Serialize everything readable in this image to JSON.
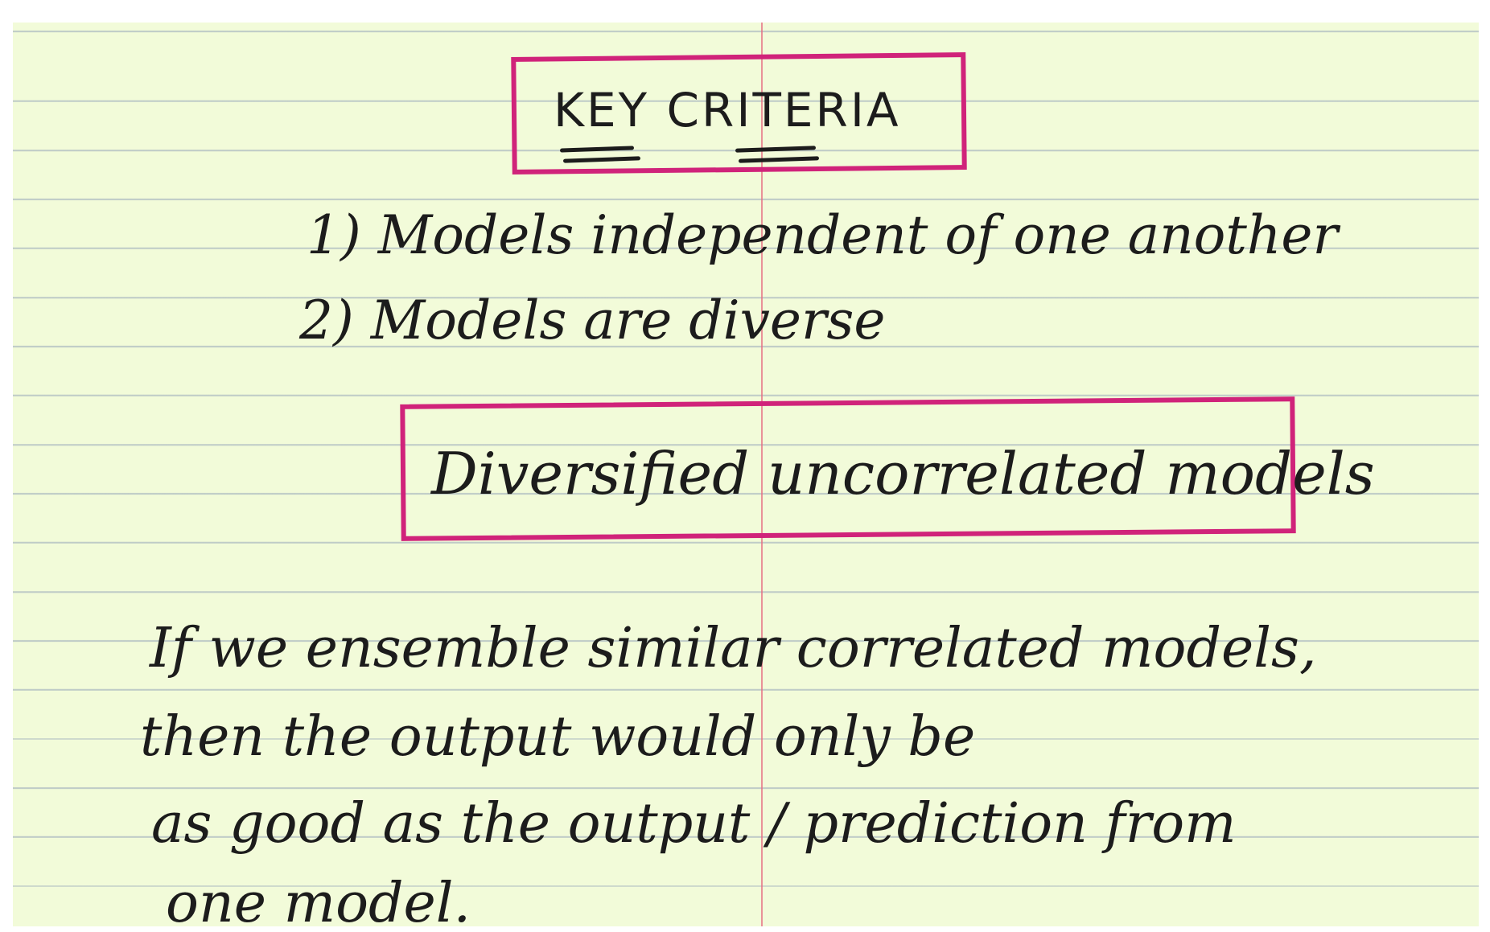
{
  "note": {
    "title": "KEY CRITERIA",
    "criteria": [
      "1) Models independent of one another",
      "2) Models are diverse"
    ],
    "highlight": "Diversified uncorrelated models",
    "paragraph_lines": [
      "If we ensemble similar correlated models,",
      "then the output would only be",
      "as good as the output / prediction from",
      "one model."
    ]
  },
  "colors": {
    "paper": "#f2fbd9",
    "rule_lines": "#96a5b9",
    "margin_line": "#e66e82",
    "box_ink": "#d0237a",
    "pen_ink": "#1c1c1c"
  }
}
